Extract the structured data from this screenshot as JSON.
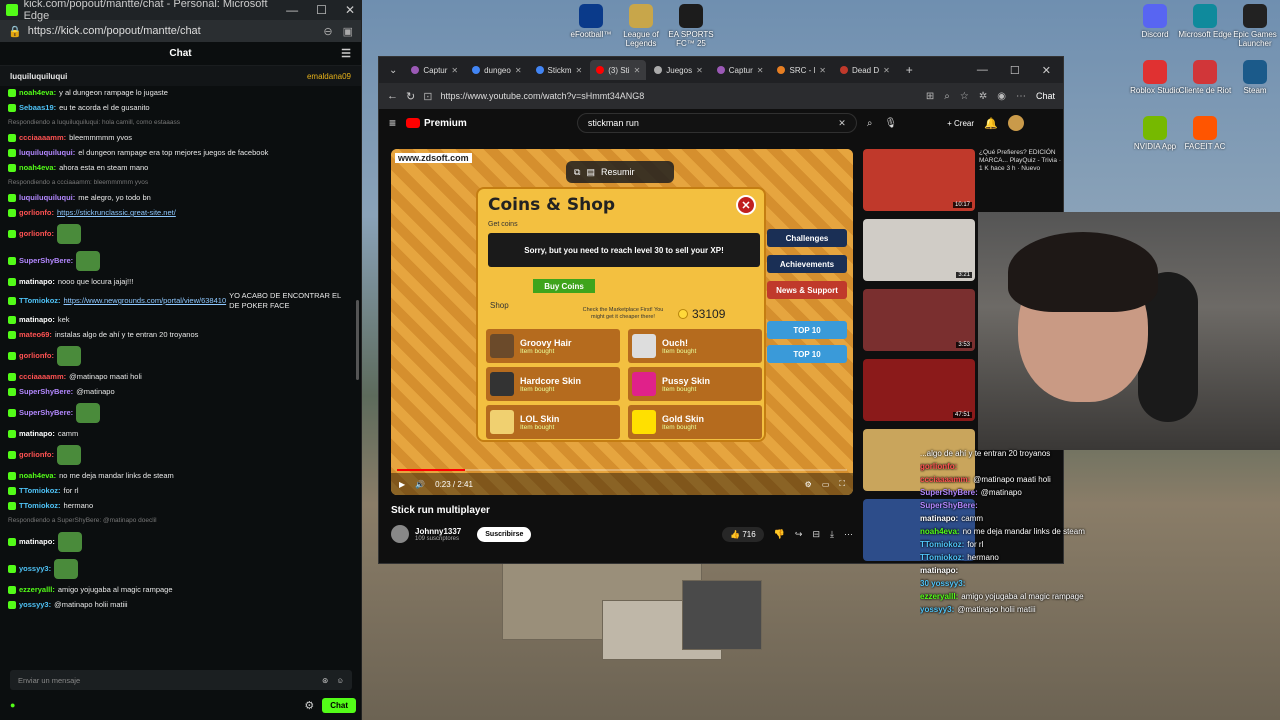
{
  "kick": {
    "window_title": "kick.com/popout/mantte/chat - Personal: Microsoft Edge",
    "url": "https://kick.com/popout/mantte/chat",
    "chat_title": "Chat",
    "pinned_user": "luquiluquiluqui",
    "pinned_right": "emaldana09",
    "messages": [
      {
        "user": "noah4eva:",
        "color": "#53fc18",
        "text": "y al dungeon rampage lo jugaste"
      },
      {
        "user": "Sebaas19:",
        "color": "#4fc3f7",
        "text": "eu te acorda el de gusanito"
      },
      {
        "reply": "Respondiendo a luquiluquiluqui: hola camill, como estaaass",
        "user": "ccciaaaamm:",
        "color": "#ff5252",
        "text": "bleemmmmm yvos"
      },
      {
        "user": "luquiluquiluqui:",
        "color": "#b388ff",
        "text": "el dungeon rampage era top mejores juegos de facebook"
      },
      {
        "user": "noah4eva:",
        "color": "#53fc18",
        "text": "ahora esta en steam mano"
      },
      {
        "reply": "Respondiendo a ccciaaamm: bleemmmmm yvos",
        "user": "luquiluquiluqui:",
        "color": "#b388ff",
        "text": "me alegro, yo todo bn"
      },
      {
        "user": "gorlionfo:",
        "color": "#ff5252",
        "link": "https://stickrunclassic.great-site.net/"
      },
      {
        "user": "gorlionfo:",
        "color": "#ff5252",
        "text": ""
      },
      {
        "user": "SuperShyBere:",
        "color": "#b388ff",
        "text": ""
      },
      {
        "user": "matinapo:",
        "color": "#ffffff",
        "text": "nooo que locura jajaj!!!"
      },
      {
        "user": "TTomiokoz:",
        "color": "#4fc3f7",
        "link": "https://www.newgrounds.com/portal/view/638410",
        "text": "YO ACABO DE ENCONTRAR EL DE POKER FACE"
      },
      {
        "user": "matinapo:",
        "color": "#ffffff",
        "text": "kek"
      },
      {
        "user": "mateo69:",
        "color": "#ff5252",
        "text": "instalas algo de ahí y te entran 20 troyanos"
      },
      {
        "user": "gorlionfo:",
        "color": "#ff5252",
        "text": ""
      },
      {
        "user": "ccciaaaamm:",
        "color": "#ff5252",
        "text": "@matinapo maati holi"
      },
      {
        "user": "SuperShyBere:",
        "color": "#b388ff",
        "text": "@matinapo"
      },
      {
        "user": "SuperShyBere:",
        "color": "#b388ff",
        "text": ""
      },
      {
        "user": "matinapo:",
        "color": "#ffffff",
        "text": "camm"
      },
      {
        "user": "gorlionfo:",
        "color": "#ff5252",
        "text": ""
      },
      {
        "user": "noah4eva:",
        "color": "#53fc18",
        "text": "no me deja mandar links de steam"
      },
      {
        "user": "TTomiokoz:",
        "color": "#4fc3f7",
        "text": "for rl"
      },
      {
        "user": "TTomiokoz:",
        "color": "#4fc3f7",
        "text": "hermano"
      },
      {
        "reply": "Respondiendo a SuperShyBere: @matinapo doeclil",
        "user": "matinapo:",
        "color": "#ffffff",
        "text": ""
      },
      {
        "user": "yossyy3:",
        "color": "#4fc3f7",
        "text": ""
      },
      {
        "user": "ezzeryalll:",
        "color": "#53fc18",
        "text": "amigo yojugaba al magic rampage"
      },
      {
        "user": "yossyy3:",
        "color": "#4fc3f7",
        "text": "@matinapo holii matiii"
      }
    ],
    "input_placeholder": "Enviar un mensaje",
    "send_label": "Chat"
  },
  "desktop_icons": [
    {
      "label": "eFootball™",
      "color": "#0a3a8a"
    },
    {
      "label": "League of Legends",
      "color": "#c8a64a"
    },
    {
      "label": "EA SPORTS FC™ 25",
      "color": "#1c1c1c"
    },
    {
      "label": "Discord",
      "color": "#5865f2"
    },
    {
      "label": "Microsoft Edge",
      "color": "#0f8a9c"
    },
    {
      "label": "Epic Games Launcher",
      "color": "#222222"
    },
    {
      "label": "Roblox Studio",
      "color": "#e03131"
    },
    {
      "label": "Cliente de Riot",
      "color": "#d13639"
    },
    {
      "label": "Steam",
      "color": "#1b5a8a"
    },
    {
      "label": "NVIDIA App",
      "color": "#76b900"
    },
    {
      "label": "FACEIT AC",
      "color": "#ff5500"
    }
  ],
  "browser": {
    "tabs": [
      {
        "label": "Captur",
        "color": "#9b59b6"
      },
      {
        "label": "dungeo",
        "color": "#4285f4"
      },
      {
        "label": "Stickm",
        "color": "#4285f4"
      },
      {
        "label": "(3) Sti",
        "color": "#ff0000"
      },
      {
        "label": "Juegos",
        "color": "#aaaaaa"
      },
      {
        "label": "Captur",
        "color": "#9b59b6"
      },
      {
        "label": "SRC - l",
        "color": "#e67e22"
      },
      {
        "label": "Dead D",
        "color": "#c0392b"
      }
    ],
    "url": "https://www.youtube.com/watch?v=sHmmt34ANG8",
    "chat_label": "Chat"
  },
  "youtube": {
    "logo": "Premium",
    "search": "stickman run",
    "create_label": "Crear",
    "video_title": "Stick run multiplayer",
    "channel": "Johnny1337",
    "subs": "109 suscriptores",
    "subscribe": "Suscribirse",
    "likes": "716",
    "time": "0:23 / 2:41",
    "progress": 0.15,
    "resumir": "Resumir",
    "watermark": "www.zdsoft.com",
    "shop": {
      "title": "Coins & Shop",
      "get_coins": "Get coins",
      "sorry": "Sorry, but you need to reach level 30 to sell your XP!",
      "buy_coins": "Buy Coins",
      "shop_label": "Shop",
      "market_note": "Check the Marketplace First! You might get it cheaper there!",
      "coins": "33109",
      "items": [
        {
          "name": "Groovy Hair",
          "status": "Item bought",
          "color": "#6b4a2a"
        },
        {
          "name": "Ouch!",
          "status": "Item bought",
          "color": "#dddddd"
        },
        {
          "name": "Hardcore Skin",
          "status": "Item bought",
          "color": "#333333"
        },
        {
          "name": "Pussy Skin",
          "status": "Item bought",
          "color": "#e0218a"
        },
        {
          "name": "LOL Skin",
          "status": "Item bought",
          "color": "#f0d070"
        },
        {
          "name": "Gold Skin",
          "status": "Item bought",
          "color": "#ffe000"
        }
      ],
      "side_buttons": [
        "Challenges",
        "Achievements",
        "News & Support",
        "TOP 10",
        "TOP 10"
      ]
    },
    "recommendations": [
      {
        "meta": "¿Qué Prefieres? EDICIÓN MARCA... PlayQuiz - Trivia · 1 K hace 3 h · Nuevo",
        "duration": "10:17",
        "color": "#c0392b"
      },
      {
        "meta": "",
        "duration": "3:21",
        "color": "#d0ccc6"
      },
      {
        "meta": "",
        "duration": "3:53",
        "color": "#7a2f2f"
      },
      {
        "meta": "",
        "duration": "47:51",
        "color": "#8b1a1a"
      },
      {
        "meta": "",
        "duration": "",
        "color": "#c9a55c"
      },
      {
        "meta": "",
        "duration": "",
        "color": "#2d4d8a"
      }
    ]
  },
  "overlay": {
    "messages": [
      {
        "user": "",
        "color": "#ffffff",
        "text": "...algo de ahí y te entran 20 troyanos"
      },
      {
        "user": "gorlionfo:",
        "color": "#ff5252",
        "text": ""
      },
      {
        "user": "ccciaaaamm:",
        "color": "#ff5252",
        "text": "@matinapo maati holi"
      },
      {
        "user": "SuperShyBere:",
        "color": "#b388ff",
        "text": "@matinapo"
      },
      {
        "user": "SuperShyBere:",
        "color": "#b388ff",
        "text": ""
      },
      {
        "user": "matinapo:",
        "color": "#ffffff",
        "text": "camm"
      },
      {
        "user": "noah4eva:",
        "color": "#53fc18",
        "text": "no me deja mandar links de steam"
      },
      {
        "user": "TTomiokoz:",
        "color": "#4fc3f7",
        "text": "for rl"
      },
      {
        "user": "TTomiokoz:",
        "color": "#4fc3f7",
        "text": "hermano"
      },
      {
        "user": "matinapo:",
        "color": "#ffffff",
        "text": ""
      },
      {
        "user": "30 yossyy3:",
        "color": "#4fc3f7",
        "text": ""
      },
      {
        "user": "ezzeryalll:",
        "color": "#53fc18",
        "text": "amigo yojugaba al magic rampage"
      },
      {
        "user": "yossyy3:",
        "color": "#4fc3f7",
        "text": "@matinapo holii matiii"
      }
    ]
  }
}
